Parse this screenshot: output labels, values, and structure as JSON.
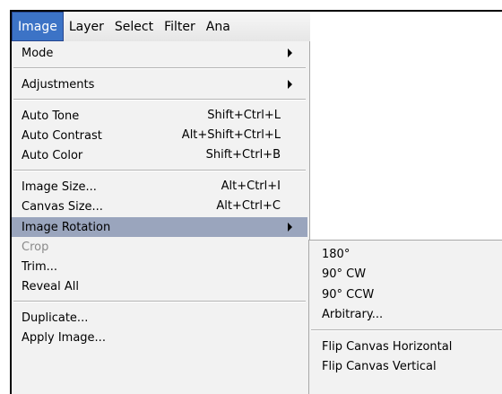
{
  "menubar": {
    "items": [
      {
        "label": "Image"
      },
      {
        "label": "Layer"
      },
      {
        "label": "Select"
      },
      {
        "label": "Filter"
      },
      {
        "label": "Ana"
      }
    ]
  },
  "image_menu": {
    "mode": "Mode",
    "adjustments": "Adjustments",
    "auto_tone": "Auto Tone",
    "auto_tone_sc": "Shift+Ctrl+L",
    "auto_contrast": "Auto Contrast",
    "auto_contrast_sc": "Alt+Shift+Ctrl+L",
    "auto_color": "Auto Color",
    "auto_color_sc": "Shift+Ctrl+B",
    "image_size": "Image Size...",
    "image_size_sc": "Alt+Ctrl+I",
    "canvas_size": "Canvas Size...",
    "canvas_size_sc": "Alt+Ctrl+C",
    "image_rotation": "Image Rotation",
    "crop": "Crop",
    "trim": "Trim...",
    "reveal_all": "Reveal All",
    "duplicate": "Duplicate...",
    "apply_image": "Apply Image..."
  },
  "rotation_submenu": {
    "r180": "180°",
    "r90cw": "90° CW",
    "r90ccw": "90° CCW",
    "arbitrary": "Arbitrary...",
    "flip_h": "Flip Canvas Horizontal",
    "flip_v": "Flip Canvas Vertical"
  }
}
